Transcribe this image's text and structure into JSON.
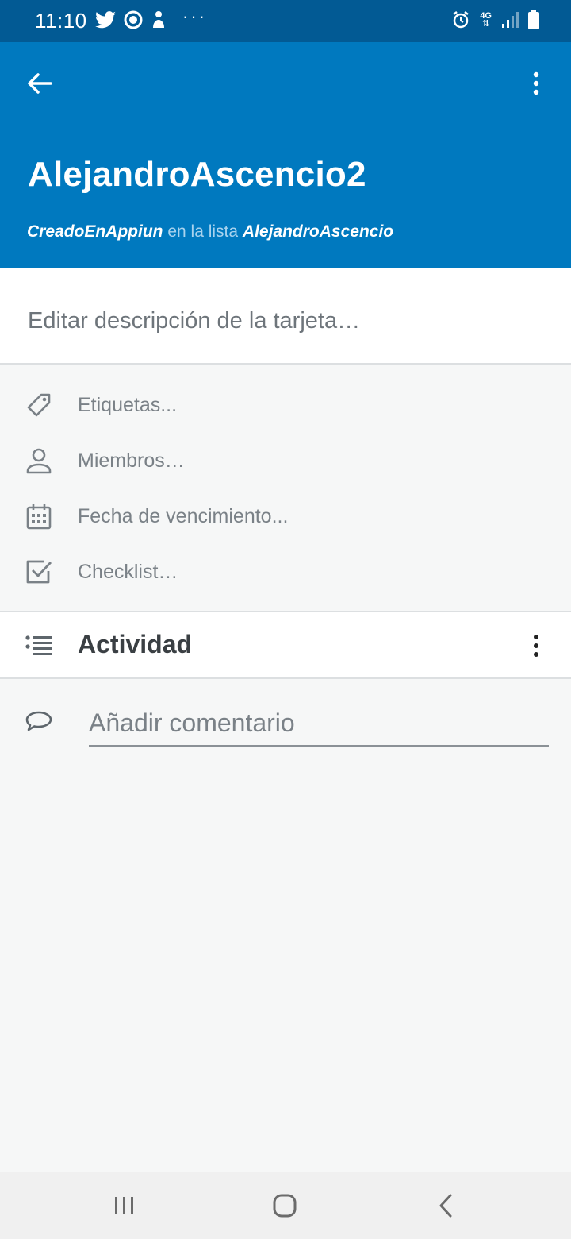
{
  "status_bar": {
    "time": "11:10",
    "network": "4G",
    "left_icons": [
      "twitter-icon",
      "app-icon",
      "person-icon"
    ],
    "right_icons": [
      "alarm-icon",
      "network-icon",
      "signal-icon",
      "battery-icon"
    ]
  },
  "app_bar": {
    "title": "AlejandroAscencio2",
    "board_name": "CreadoEnAppiun",
    "list_connector": "en la lista",
    "list_name": "AlejandroAscencio"
  },
  "description": {
    "placeholder": "Editar descripción de la tarjeta…"
  },
  "meta": {
    "labels": "Etiquetas...",
    "members": "Miembros…",
    "due_date": "Fecha de vencimiento...",
    "checklist": "Checklist…"
  },
  "activity": {
    "title": "Actividad"
  },
  "comment": {
    "placeholder": "Añadir comentario"
  },
  "colors": {
    "status_bar": "#025a94",
    "app_bar": "#0079bf",
    "background": "#f6f7f7"
  }
}
